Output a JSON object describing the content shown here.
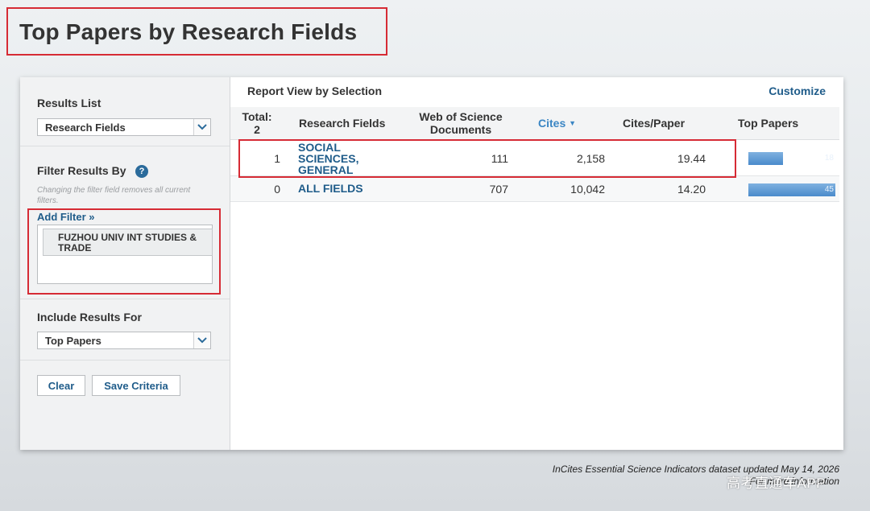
{
  "page_title": "Top Papers by Research Fields",
  "sidebar": {
    "results_list": {
      "label": "Results List",
      "selected": "Research Fields"
    },
    "filter": {
      "label": "Filter Results By",
      "help_icon": "?",
      "note": "Changing the filter field removes all current filters.",
      "add_filter_label": "Add Filter »",
      "active_filters": [
        "FUZHOU UNIV INT STUDIES & TRADE"
      ]
    },
    "include": {
      "label": "Include Results For",
      "selected": "Top Papers"
    },
    "buttons": {
      "clear": "Clear",
      "save": "Save Criteria"
    }
  },
  "report": {
    "title": "Report View by Selection",
    "customize": "Customize",
    "columns": {
      "total": "Total: 2",
      "research_fields": "Research Fields",
      "wos_documents": "Web of Science Documents",
      "cites": "Cites",
      "cites_per_paper": "Cites/Paper",
      "top_papers": "Top Papers"
    },
    "rows": [
      {
        "rank": "1",
        "field": "SOCIAL SCIENCES, GENERAL",
        "documents": "111",
        "cites": "2,158",
        "cites_per_paper": "19.44",
        "top_papers": 18,
        "top_papers_label": "18"
      },
      {
        "rank": "0",
        "field": "ALL FIELDS",
        "documents": "707",
        "cites": "10,042",
        "cites_per_paper": "14.20",
        "top_papers": 45,
        "top_papers_label": "45"
      }
    ],
    "bar_max": 45
  },
  "footer": {
    "line1": "InCites Essential Science Indicators dataset updated May 14, 2026",
    "line2": "For more information"
  },
  "watermark": "高考直通车APP",
  "colors": {
    "accent": "#1f5c8a",
    "highlight": "#d62b35",
    "bar": "#4a8acb"
  }
}
